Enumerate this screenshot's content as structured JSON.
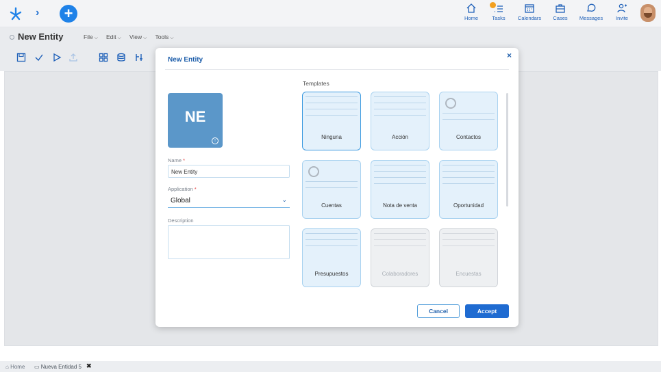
{
  "topbar": {
    "nav": [
      {
        "label": "Home",
        "icon": "home-icon"
      },
      {
        "label": "Tasks",
        "icon": "tasks-icon"
      },
      {
        "label": "Calendars",
        "icon": "calendar-icon"
      },
      {
        "label": "Cases",
        "icon": "cases-icon"
      },
      {
        "label": "Messages",
        "icon": "messages-icon"
      },
      {
        "label": "Invite",
        "icon": "invite-icon"
      }
    ],
    "plus_label": "+"
  },
  "titlebar": {
    "entity_title": "New Entity",
    "menus": [
      "File",
      "Edit",
      "View",
      "Tools"
    ]
  },
  "dialog": {
    "title": "New Entity",
    "close": "×",
    "initials": "NE",
    "name_label": "Name",
    "name_value": "New Entity",
    "application_label": "Application",
    "application_value": "Global",
    "description_label": "Description",
    "required_mark": "*",
    "templates_heading": "Templates",
    "templates": [
      {
        "name": "Ninguna",
        "selected": true,
        "faded": false
      },
      {
        "name": "Acción",
        "selected": false,
        "faded": false
      },
      {
        "name": "Contactos",
        "selected": false,
        "faded": false
      },
      {
        "name": "Cuentas",
        "selected": false,
        "faded": false
      },
      {
        "name": "Nota de venta",
        "selected": false,
        "faded": false
      },
      {
        "name": "Oportunidad",
        "selected": false,
        "faded": false
      },
      {
        "name": "Presupuestos",
        "selected": false,
        "faded": false
      },
      {
        "name": "Colaboradores",
        "selected": false,
        "faded": true
      },
      {
        "name": "Encuestas",
        "selected": false,
        "faded": true
      }
    ],
    "cancel_label": "Cancel",
    "accept_label": "Accept"
  },
  "footer": {
    "home_label": "Home",
    "tab_label": "Nueva Entidad 5",
    "tab_close": "✖"
  },
  "colors": {
    "accent": "#1f6bd1",
    "avatar_tile": "#5b97c9",
    "task_badge": "#f2a020"
  }
}
